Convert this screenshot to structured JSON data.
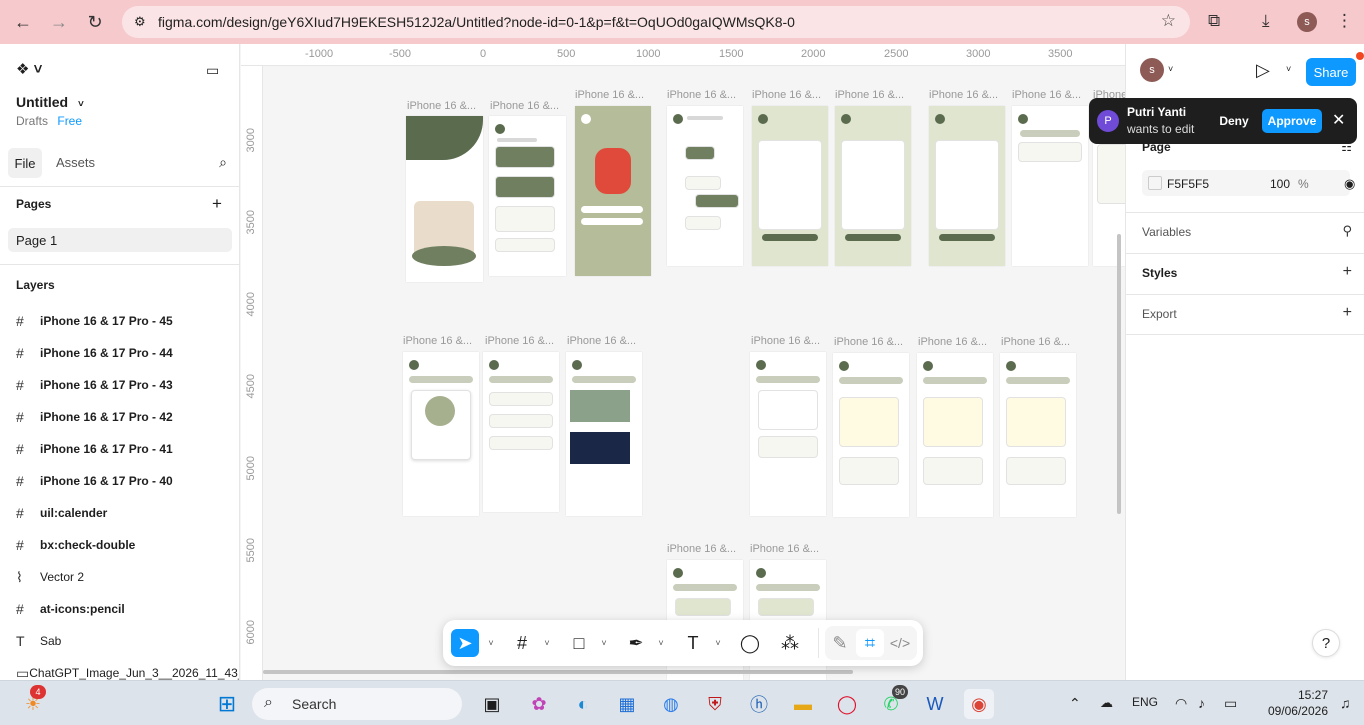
{
  "browser": {
    "url": "figma.com/design/geY6XIud7H9EKESH512J2a/Untitled?node-id=0-1&p=f&t=OqUOd0gaIQWMsQK8-0",
    "profile_initial": "s"
  },
  "file": {
    "name": "Untitled",
    "location": "Drafts",
    "plan": "Free"
  },
  "left_panel": {
    "tab_file": "File",
    "tab_assets": "Assets",
    "pages_title": "Pages",
    "pages": [
      "Page 1"
    ],
    "layers_title": "Layers",
    "layers": [
      {
        "icon": "#",
        "name": "iPhone 16 & 17 Pro - 45"
      },
      {
        "icon": "#",
        "name": "iPhone 16 & 17 Pro - 44"
      },
      {
        "icon": "#",
        "name": "iPhone 16 & 17 Pro - 43"
      },
      {
        "icon": "#",
        "name": "iPhone 16 & 17 Pro - 42"
      },
      {
        "icon": "#",
        "name": "iPhone 16 & 17 Pro - 41"
      },
      {
        "icon": "#",
        "name": "iPhone 16 & 17 Pro - 40"
      },
      {
        "icon": "#",
        "name": "uil:calender"
      },
      {
        "icon": "#",
        "name": "bx:check-double"
      },
      {
        "icon": "⌇",
        "name": "Vector 2"
      },
      {
        "icon": "#",
        "name": "at-icons:pencil"
      },
      {
        "icon": "T",
        "name": "Sab"
      },
      {
        "icon": "▭",
        "name": "ChatGPT_Image_Jun_3__2026_11_43_"
      }
    ]
  },
  "ruler": {
    "x_ticks": [
      "-1000",
      "-500",
      "0",
      "500",
      "1000",
      "1500",
      "2000",
      "2500",
      "3000",
      "3500"
    ],
    "y_ticks": [
      "3000",
      "3500",
      "4000",
      "4500",
      "5000",
      "5500",
      "6000"
    ]
  },
  "frames": {
    "label": "iPhone 16 &..."
  },
  "right_panel": {
    "user_initial": "s",
    "share": "Share",
    "page_title": "Page",
    "page_color": "F5F5F5",
    "page_opacity": "100",
    "percent": "%",
    "variables": "Variables",
    "styles": "Styles",
    "export": "Export"
  },
  "notification": {
    "initial": "P",
    "name": "Putri Yanti",
    "message": "wants to edit",
    "deny": "Deny",
    "approve": "Approve"
  },
  "taskbar": {
    "weather_badge": "4",
    "search_placeholder": "Search",
    "whatsapp_badge": "90",
    "language": "ENG",
    "time": "15:27",
    "date": "09/06/2026"
  },
  "colors": {
    "browser_bar": "#f6c9cd",
    "figma_blue": "#0d99ff",
    "frame_green": "#5a6b4e",
    "canvas": "#f5f5f5"
  }
}
